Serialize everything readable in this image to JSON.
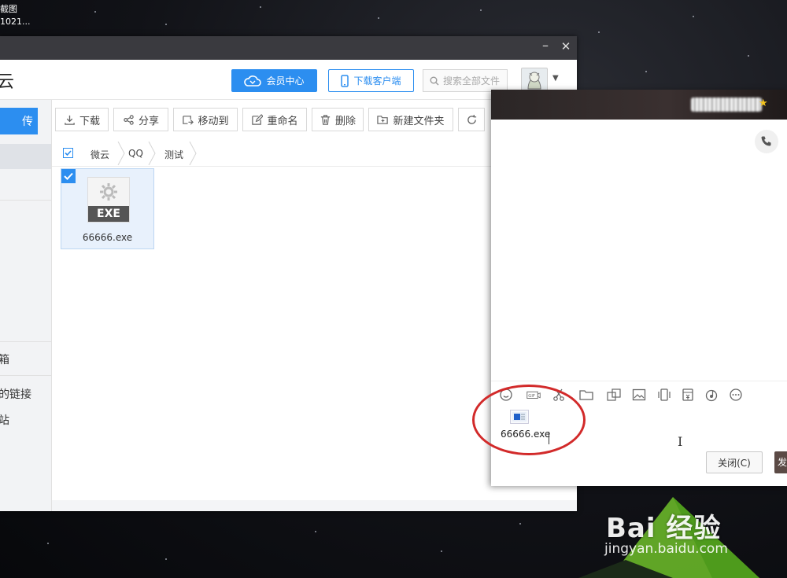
{
  "desktop": {
    "label_line1": "截图",
    "label_line2": "1021...",
    "watermark": "Bai 经验",
    "watermark_url": "jingyan.baidu.com"
  },
  "weiyun": {
    "brand": "云",
    "header": {
      "vip_label": "会员中心",
      "client_label": "下载客户端",
      "search_placeholder": "搜索全部文件"
    },
    "sidebar": {
      "upload_label": "传",
      "items": [
        {
          "label": "箱"
        },
        {
          "label": "的链接"
        },
        {
          "label": "站"
        }
      ]
    },
    "toolbar": [
      {
        "label": "下载",
        "icon": "download-icon"
      },
      {
        "label": "分享",
        "icon": "share-icon"
      },
      {
        "label": "移动到",
        "icon": "move-icon"
      },
      {
        "label": "重命名",
        "icon": "rename-icon"
      },
      {
        "label": "删除",
        "icon": "trash-icon"
      },
      {
        "label": "新建文件夹",
        "icon": "new-folder-icon"
      }
    ],
    "breadcrumb": [
      "微云",
      "QQ",
      "测试"
    ],
    "file": {
      "badge": "EXE",
      "name": "66666.exe"
    }
  },
  "qq_chat": {
    "attachment_name": "66666.exe",
    "close_label": "关闭(C)",
    "send_label": "发",
    "tools": [
      "smile-icon",
      "gif-icon",
      "scissors-icon",
      "folder-icon",
      "screenshot-icon",
      "image-icon",
      "shake-icon",
      "red-packet-icon",
      "music-icon",
      "more-icon"
    ]
  },
  "colors": {
    "accent": "#2c8ef0",
    "annotation_red": "#d22a2a"
  }
}
